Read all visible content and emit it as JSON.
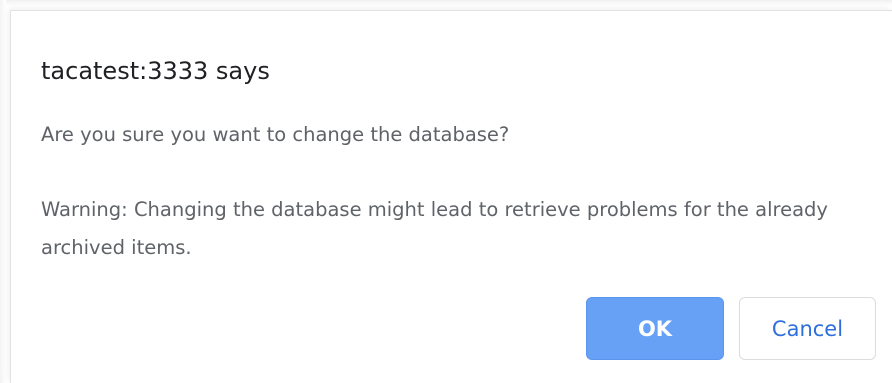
{
  "dialog": {
    "title": "tacatest:3333 says",
    "message_line1": "Are you sure you want to change the database?",
    "message_line2": "Warning: Changing the database might lead to retrieve problems for the already archived items.",
    "ok_label": "OK",
    "cancel_label": "Cancel"
  },
  "colors": {
    "ok_button_bg": "#66a1f6",
    "cancel_text": "#2f6fdc",
    "message_text": "#5f6368",
    "title_text": "#202124"
  }
}
